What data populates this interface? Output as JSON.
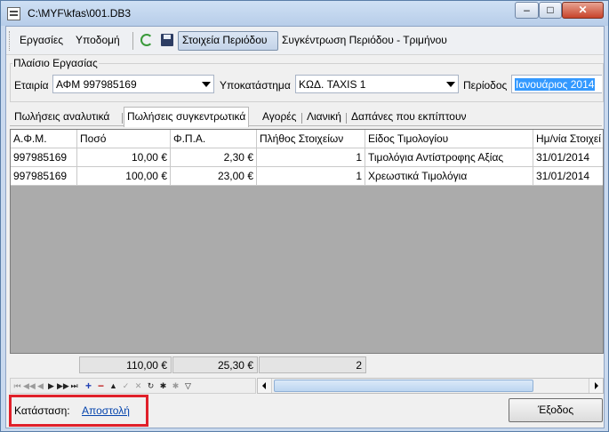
{
  "window": {
    "title": "C:\\MYF\\kfas\\001.DB3",
    "minimize_glyph": "–",
    "maximize_glyph": "□",
    "close_glyph": "✕"
  },
  "toolbar": {
    "menu_tasks": "Εργασίες",
    "menu_infrastructure": "Υποδομή",
    "refresh_icon": "refresh-icon",
    "save_icon": "save-icon",
    "period_data": "Στοιχεία Περιόδου",
    "period_summary": "Συγκέντρωση Περιόδου - Τριμήνου"
  },
  "work_frame": {
    "title": "Πλαίσιο Εργασίας",
    "company_label": "Εταιρία",
    "company_value": "ΑΦΜ 997985169",
    "branch_label": "Υποκατάστημα",
    "branch_value": "ΚΩΔ. TAXIS 1",
    "period_label": "Περίοδος",
    "period_value": "Ιανουάριος 2014"
  },
  "tabs": [
    {
      "label": "Πωλήσεις αναλυτικά"
    },
    {
      "label": "Πωλήσεις συγκεντρωτικά",
      "active": true
    },
    {
      "label": "Αγορές"
    },
    {
      "label": "Λιανική"
    },
    {
      "label": "Δαπάνες που εκπίπτουν"
    }
  ],
  "table": {
    "columns": [
      "Α.Φ.Μ.",
      "Ποσό",
      "Φ.Π.Α.",
      "Πλήθος Στοιχείων",
      "Είδος Τιμολογίου",
      "Ημ/νία Στοιχεί"
    ],
    "rows": [
      [
        "997985169",
        "10,00 €",
        "2,30 €",
        "1",
        "Τιμολόγια Αντίστροφης Αξίας",
        "31/01/2014"
      ],
      [
        "997985169",
        "100,00 €",
        "23,00 €",
        "1",
        "Χρεωστικά Τιμολόγια",
        "31/01/2014"
      ]
    ],
    "totals": {
      "amount": "110,00 €",
      "vat": "25,30 €",
      "count": "2"
    }
  },
  "navigator": {
    "first": "⏮",
    "prior_page": "◀◀",
    "prior": "◀",
    "next": "▶",
    "next_page": "▶▶",
    "last": "⏭",
    "insert": "+",
    "delete": "−",
    "edit": "▲",
    "post": "✓",
    "cancel": "✕",
    "refresh": "↻",
    "apply_filter": "✱",
    "clear_filter": "✱",
    "filter": "▽"
  },
  "status": {
    "label": "Κατάσταση:",
    "value": "Αποστολή"
  },
  "buttons": {
    "exit": "Έξοδος"
  },
  "colors": {
    "highlight_box": "#e0202a",
    "selection": "#3399ff",
    "link": "#0645ad"
  }
}
